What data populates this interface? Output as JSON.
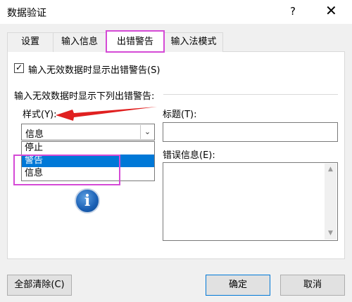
{
  "window": {
    "title": "数据验证",
    "help_label": "?",
    "close_label": "✕"
  },
  "tabs": [
    {
      "label": "设置"
    },
    {
      "label": "输入信息"
    },
    {
      "label": "出错警告"
    },
    {
      "label": "输入法模式"
    }
  ],
  "active_tab": "出错警告",
  "show_error_checkbox": {
    "label": "输入无效数据时显示出错警告(S)",
    "checked": true,
    "mark": "✓"
  },
  "group_label": "输入无效数据时显示下列出错警告:",
  "style": {
    "label": "样式(Y):",
    "selected": "信息",
    "dropdown_arrow": "⌄",
    "options": [
      "停止",
      "警告",
      "信息"
    ],
    "highlighted_option": "警告"
  },
  "title_field": {
    "label": "标题(T):",
    "value": ""
  },
  "error_message_field": {
    "label": "错误信息(E):",
    "value": ""
  },
  "icon": {
    "name": "info-icon",
    "glyph": "i"
  },
  "buttons": {
    "clear_all": "全部清除(C)",
    "ok": "确定",
    "cancel": "取消"
  },
  "colors": {
    "highlight": "#d54ad6",
    "arrow": "#e02020",
    "selection": "#0078d7"
  }
}
